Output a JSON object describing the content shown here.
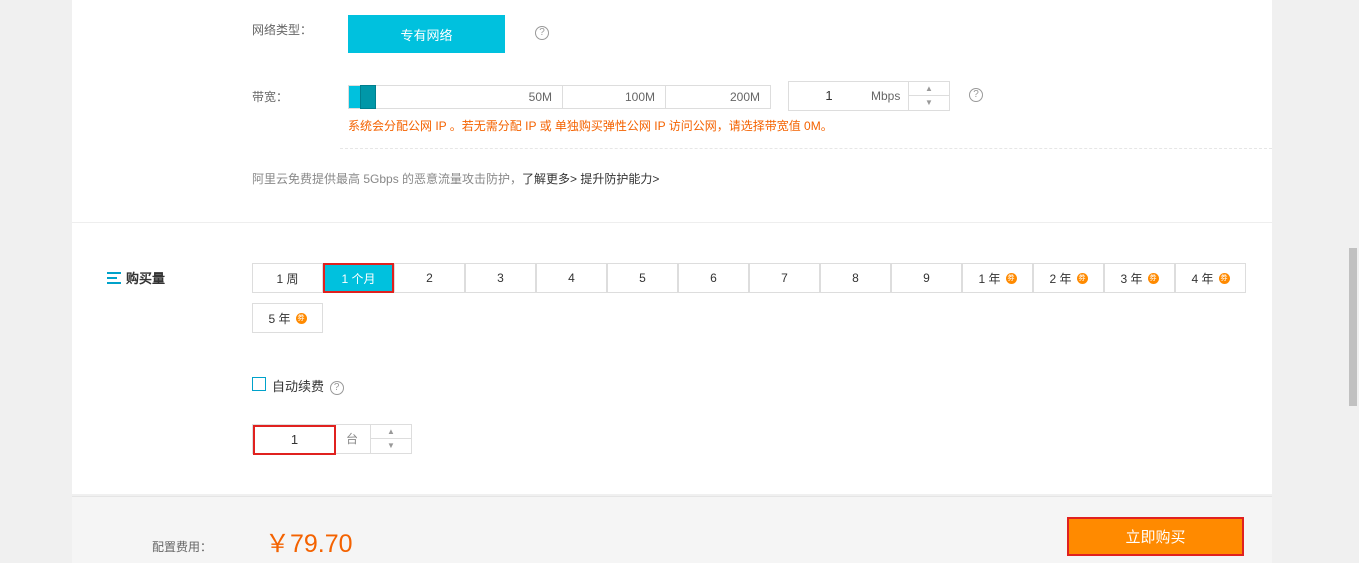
{
  "network": {
    "label": "网络类型：",
    "type_button": "专有网络",
    "help": "?"
  },
  "bandwidth": {
    "label": "带宽：",
    "ticks": [
      "50M",
      "100M",
      "200M"
    ],
    "value": "1",
    "unit": "Mbps",
    "fill_fraction": 0.005,
    "help": "?",
    "warning": "系统会分配公网 IP 。若无需分配 IP 或 单独购买弹性公网 IP 访问公网，请选择带宽值 0M。"
  },
  "ddos": {
    "text": "阿里云免费提供最高 5Gbps 的恶意流量攻击防护，",
    "learn_more": "了解更多>",
    "upgrade": "提升防护能力>"
  },
  "purchase": {
    "title": "购买量",
    "periods": [
      {
        "label": "1 周",
        "coin": false
      },
      {
        "label": "1 个月",
        "coin": false,
        "selected": true
      },
      {
        "label": "2",
        "coin": false
      },
      {
        "label": "3",
        "coin": false
      },
      {
        "label": "4",
        "coin": false
      },
      {
        "label": "5",
        "coin": false
      },
      {
        "label": "6",
        "coin": false
      },
      {
        "label": "7",
        "coin": false
      },
      {
        "label": "8",
        "coin": false
      },
      {
        "label": "9",
        "coin": false
      },
      {
        "label": "1 年",
        "coin": true
      },
      {
        "label": "2 年",
        "coin": true
      },
      {
        "label": "3 年",
        "coin": true
      },
      {
        "label": "4 年",
        "coin": true
      },
      {
        "label": "5 年",
        "coin": true
      }
    ],
    "auto_renew_label": "自动续费",
    "auto_renew_checked": false,
    "quantity_value": "1",
    "quantity_unit": "台"
  },
  "footer": {
    "cost_label": "配置费用：",
    "price": "￥79.70",
    "buy_button": "立即购买"
  },
  "colors": {
    "accent": "#00c1de",
    "price": "#f46200",
    "buy": "#ff8a00",
    "highlight_border": "#e0211f"
  },
  "icons": {
    "stepper_up": "▲",
    "stepper_down": "▼",
    "coin": "券"
  }
}
